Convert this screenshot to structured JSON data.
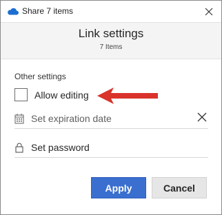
{
  "window": {
    "title": "Share 7 items",
    "app_icon": "onedrive-cloud-icon",
    "close_icon": "close-icon"
  },
  "header": {
    "title": "Link settings",
    "subtitle": "7 Items"
  },
  "settings": {
    "section_label": "Other settings",
    "allow_editing": {
      "label": "Allow editing",
      "checked": false
    },
    "expiration": {
      "placeholder": "Set expiration date",
      "icon": "calendar-icon",
      "clear_icon": "clear-x-icon"
    },
    "password": {
      "label": "Set password",
      "icon": "lock-icon"
    }
  },
  "annotation": {
    "arrow_color": "#d9332b"
  },
  "buttons": {
    "apply_label": "Apply",
    "cancel_label": "Cancel"
  },
  "colors": {
    "accent": "#3a6fd0",
    "header_bg": "#f4f4f4"
  }
}
